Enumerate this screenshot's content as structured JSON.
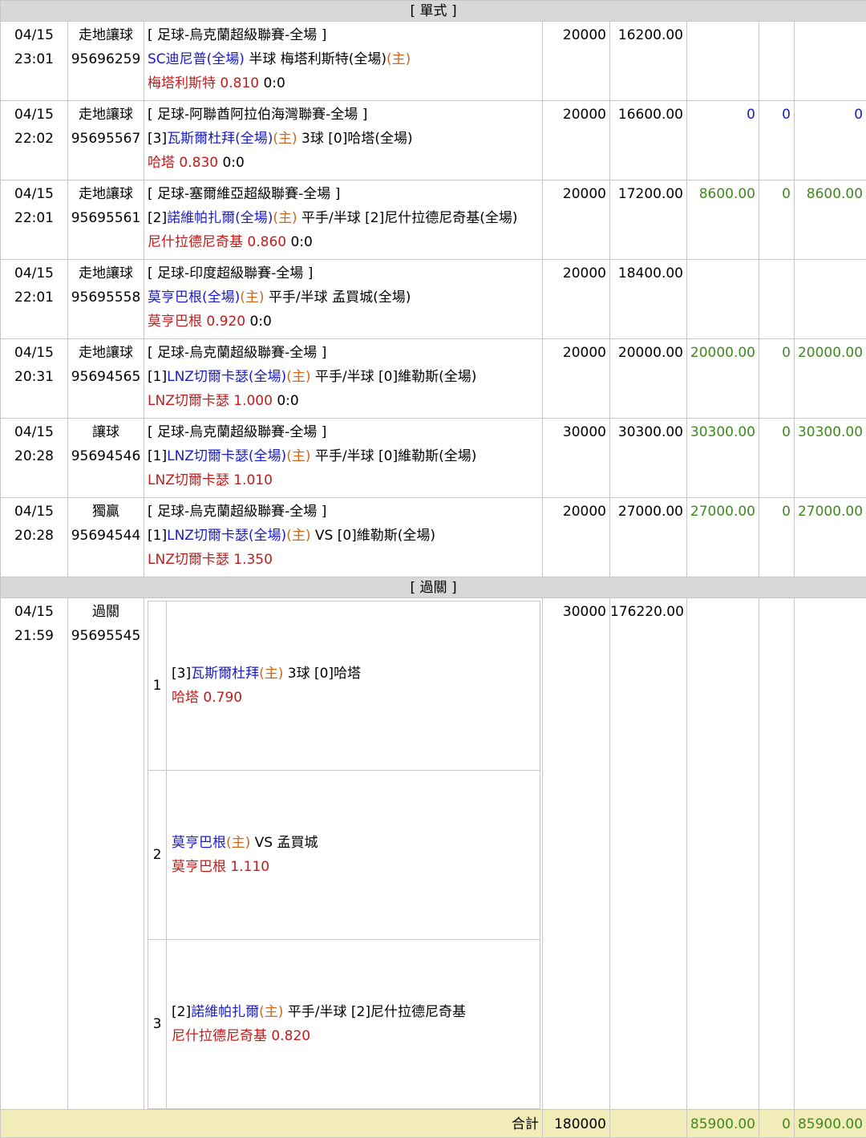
{
  "sections": {
    "single": "[ 單式 ]",
    "parlay": "[ 過關 ]"
  },
  "bets": [
    {
      "date": "04/15",
      "time": "23:01",
      "type": "走地讓球",
      "id": "95696259",
      "league": "[ 足球-烏克蘭超級聯賽-全場 ]",
      "pre": "",
      "team1": "SC迪尼普(全場)",
      "team1_home": "",
      "mid": " 半球 梅塔利斯特(全場)",
      "home_tail": "(主)",
      "team2": "",
      "pick": "梅塔利斯特",
      "odds": "0.810",
      "score": "0:0",
      "stake": "20000",
      "payout": "16200.00",
      "win": "",
      "c2": "",
      "c3": ""
    },
    {
      "date": "04/15",
      "time": "22:02",
      "type": "走地讓球",
      "id": "95695567",
      "league": "[ 足球-阿聯酋阿拉伯海灣聯賽-全場 ]",
      "pre": "[3]",
      "team1": "瓦斯爾杜拜(全場)",
      "team1_home": "(主)",
      "mid": " 3球 [0]哈塔(全場)",
      "home_tail": "",
      "team2": "",
      "pick": "哈塔",
      "odds": "0.830",
      "score": "0:0",
      "stake": "20000",
      "payout": "16600.00",
      "win": "0",
      "c2": "0",
      "c3": "0",
      "blue": true
    },
    {
      "date": "04/15",
      "time": "22:01",
      "type": "走地讓球",
      "id": "95695561",
      "league": "[ 足球-塞爾維亞超級聯賽-全場 ]",
      "pre": "[2]",
      "team1": "諾維帕扎爾(全場)",
      "team1_home": "(主)",
      "mid": " 平手/半球 [2]尼什拉德尼奇基(全場)",
      "home_tail": "",
      "team2": "",
      "pick": "尼什拉德尼奇基",
      "odds": "0.860",
      "score": "0:0",
      "stake": "20000",
      "payout": "17200.00",
      "win": "8600.00",
      "c2": "0",
      "c3": "8600.00"
    },
    {
      "date": "04/15",
      "time": "22:01",
      "type": "走地讓球",
      "id": "95695558",
      "league": "[ 足球-印度超級聯賽-全場 ]",
      "pre": "",
      "team1": "莫亨巴根(全場)",
      "team1_home": "(主)",
      "mid": " 平手/半球 孟買城(全場)",
      "home_tail": "",
      "team2": "",
      "pick": "莫亨巴根",
      "odds": "0.920",
      "score": "0:0",
      "stake": "20000",
      "payout": "18400.00",
      "win": "",
      "c2": "",
      "c3": ""
    },
    {
      "date": "04/15",
      "time": "20:31",
      "type": "走地讓球",
      "id": "95694565",
      "league": "[ 足球-烏克蘭超級聯賽-全場 ]",
      "pre": "[1]",
      "team1": "LNZ切爾卡瑟(全場)",
      "team1_home": "(主)",
      "mid": " 平手/半球 [0]維勒斯(全場)",
      "home_tail": "",
      "team2": "",
      "pick": "LNZ切爾卡瑟",
      "odds": "1.000",
      "score": "0:0",
      "stake": "20000",
      "payout": "20000.00",
      "win": "20000.00",
      "c2": "0",
      "c3": "20000.00"
    },
    {
      "date": "04/15",
      "time": "20:28",
      "type": "讓球",
      "id": "95694546",
      "league": "[ 足球-烏克蘭超級聯賽-全場 ]",
      "pre": "[1]",
      "team1": "LNZ切爾卡瑟(全場)",
      "team1_home": "(主)",
      "mid": " 平手/半球 [0]維勒斯(全場)",
      "home_tail": "",
      "team2": "",
      "pick": "LNZ切爾卡瑟",
      "odds": "1.010",
      "score": "",
      "stake": "30000",
      "payout": "30300.00",
      "win": "30300.00",
      "c2": "0",
      "c3": "30300.00"
    },
    {
      "date": "04/15",
      "time": "20:28",
      "type": "獨贏",
      "id": "95694544",
      "league": "[ 足球-烏克蘭超級聯賽-全場 ]",
      "pre": "[1]",
      "team1": "LNZ切爾卡瑟(全場)",
      "team1_home": "(主)",
      "mid": " VS [0]維勒斯(全場)",
      "home_tail": "",
      "team2": "",
      "pick": "LNZ切爾卡瑟",
      "odds": "1.350",
      "score": "",
      "stake": "20000",
      "payout": "27000.00",
      "win": "27000.00",
      "c2": "0",
      "c3": "27000.00"
    }
  ],
  "parlay": {
    "date": "04/15",
    "time": "21:59",
    "type": "過關",
    "id": "95695545",
    "stake": "30000",
    "payout": "176220.00",
    "legs": [
      {
        "n": "1",
        "pre": "[3]",
        "team": "瓦斯爾杜拜",
        "home": "(主)",
        "mid": " 3球 [0]哈塔",
        "pick": "哈塔",
        "odds": "0.790"
      },
      {
        "n": "2",
        "pre": "",
        "team": "莫亨巴根",
        "home": "(主)",
        "mid": " VS 孟買城",
        "pick": "莫亨巴根",
        "odds": "1.110"
      },
      {
        "n": "3",
        "pre": "[2]",
        "team": "諾維帕扎爾",
        "home": "(主)",
        "mid": " 平手/半球 [2]尼什拉德尼奇基",
        "pick": "尼什拉德尼奇基",
        "odds": "0.820"
      }
    ]
  },
  "total": {
    "label": "合計",
    "stake": "180000",
    "win": "85900.00",
    "c2": "0",
    "c3": "85900.00"
  }
}
